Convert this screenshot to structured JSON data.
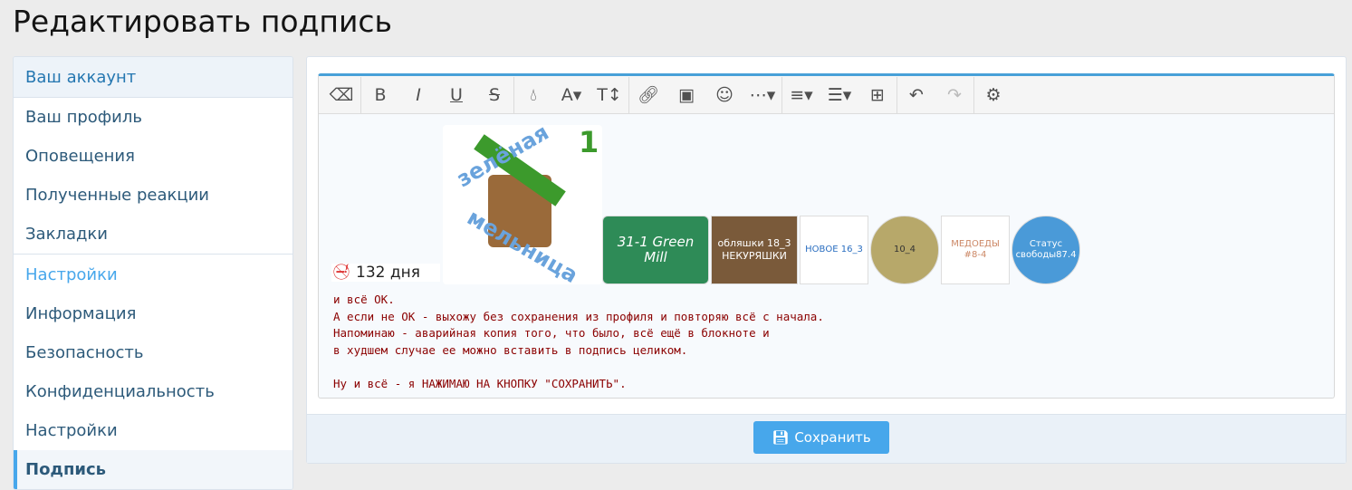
{
  "title": "Редактировать подпись",
  "sidebar": {
    "account_header": "Ваш аккаунт",
    "account_items": [
      "Ваш профиль",
      "Оповещения",
      "Полученные реакции",
      "Закладки"
    ],
    "settings_header": "Настройки",
    "settings_items": [
      "Информация",
      "Безопасность",
      "Конфиденциальность",
      "Настройки",
      "Подпись"
    ]
  },
  "toolbar": [
    "eraser-icon",
    "bold-icon",
    "italic-icon",
    "underline-icon",
    "strikethrough-icon",
    "color-icon",
    "font-family-icon",
    "font-size-icon",
    "link-icon",
    "image-icon",
    "smilie-icon",
    "more-icon",
    "align-icon",
    "list-icon",
    "table-icon",
    "undo-icon",
    "redo-icon",
    "settings-icon"
  ],
  "signature": {
    "days": "132 дня",
    "logo_text": "зелёная мельница 1",
    "badges": [
      "31-1 Green Mill",
      "обляшки 18_3 НЕКУРЯШКИ",
      "НОВОЕ 16_3",
      "10_4",
      "МЕДОЕДЫ #8-4",
      "Статус свободы87.4"
    ],
    "lines": [
      "и всё ОК.",
      "А если не ОК - выхожу без сохранения из профиля и повторяю всё с начала.",
      "Напоминаю - аварийная копия того, что было, всё ещё в блокноте и",
      "в худшем случае ее можно вставить в подпись целиком.",
      "",
      "Ну и всё - я НАЖИМАЮ НА КНОПКУ \"СОХРАНИТЬ\"."
    ]
  },
  "save_label": "Сохранить"
}
